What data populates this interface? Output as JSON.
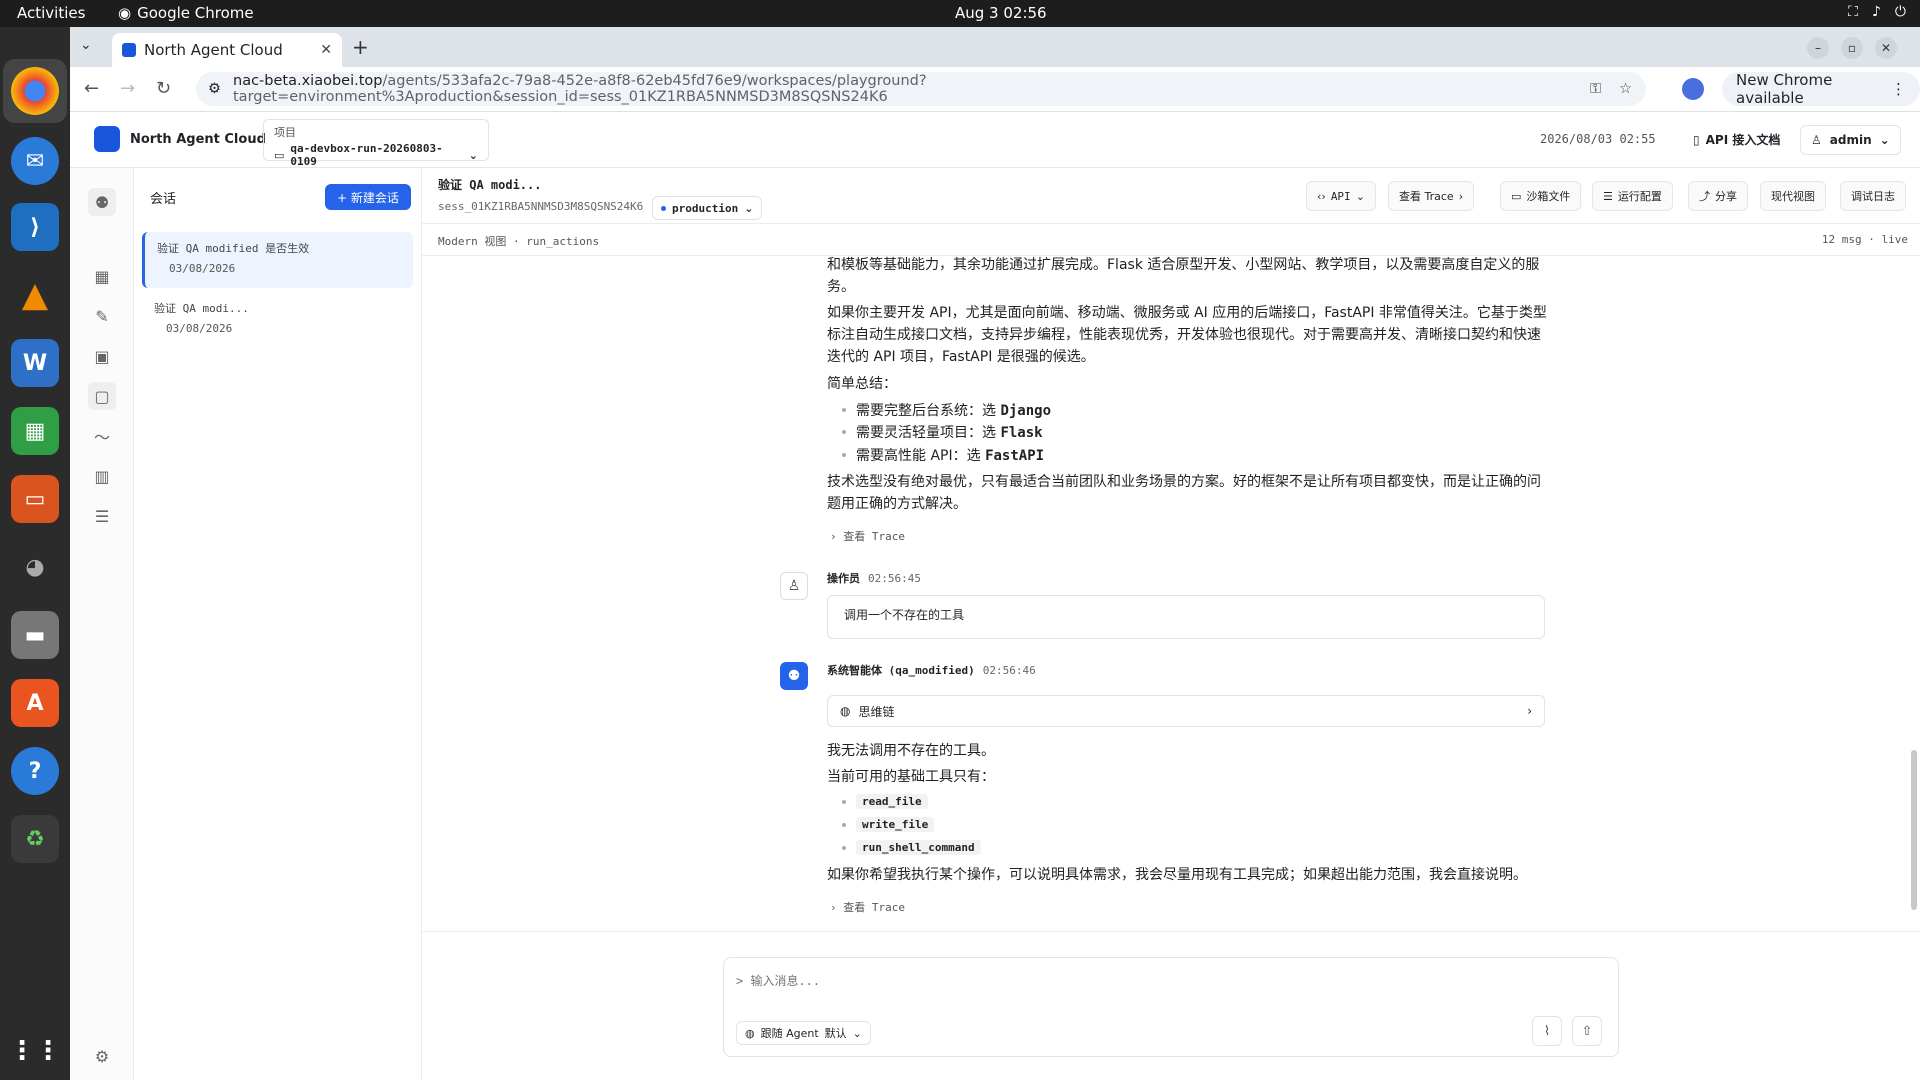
{
  "os": {
    "activities": "Activities",
    "app_name": "Google Chrome",
    "clock": "Aug 3  02:56"
  },
  "browser": {
    "tab_title": "North Agent Cloud",
    "url_host": "nac-beta.xiaobei.top",
    "url_path": "/agents/533afa2c-79a8-452e-a8f8-62eb45fd76e9/workspaces/playground?target=environment%3Aproduction&session_id=sess_01KZ1RBA5NNMSD3M8SQSNS24K6",
    "update_label": "New Chrome available"
  },
  "header": {
    "brand": "North Agent Cloud",
    "project_label": "项目",
    "project_value": "qa-devbox-run-20260803-0109",
    "datetime": "2026/08/03 02:55",
    "api_doc": "API 接入文档",
    "user": "admin"
  },
  "sessions": {
    "title": "会话",
    "new_label": "+ 新建会话",
    "items": [
      {
        "title": "验证 QA modified 是否生效",
        "date": "03/08/2026"
      },
      {
        "title": "验证 QA modi...",
        "date": "03/08/2026"
      }
    ]
  },
  "session_header": {
    "title": "验证 QA modi...",
    "id": "sess_01KZ1RBA5NNMSD3M8SQSNS24K6",
    "env": "production",
    "buttons": {
      "api": "API",
      "trace": "查看 Trace",
      "sandbox": "沙箱文件",
      "run_config": "运行配置",
      "share": "分享",
      "modern_view": "现代视图",
      "debug_log": "调试日志"
    }
  },
  "view_bar": {
    "left": "Modern 视图 · run_actions",
    "right": "12 msg · live"
  },
  "chat": {
    "p1": "和模板等基础能力，其余功能通过扩展完成。Flask 适合原型开发、小型网站、教学项目，以及需要高度自定义的服务。",
    "p2": "如果你主要开发 API，尤其是面向前端、移动端、微服务或 AI 应用的后端接口，FastAPI 非常值得关注。它基于类型标注自动生成接口文档，支持异步编程，性能表现优秀，开发体验也很现代。对于需要高并发、清晰接口契约和快速迭代的 API 项目，FastAPI 是很强的候选。",
    "summary_title": "简单总结：",
    "summary": [
      {
        "text": "需要完整后台系统：选 ",
        "bold": "Django"
      },
      {
        "text": "需要灵活轻量项目：选 ",
        "bold": "Flask"
      },
      {
        "text": "需要高性能 API：选 ",
        "bold": "FastAPI"
      }
    ],
    "p3": "技术选型没有绝对最优，只有最适合当前团队和业务场景的方案。好的框架不是让所有项目都变快，而是让正确的问题用正确的方式解决。",
    "trace_label": "查看 Trace",
    "user_msg": {
      "author": "操作员",
      "time": "02:56:45",
      "text": "调用一个不存在的工具"
    },
    "agent_msg": {
      "author": "系统智能体 (qa_modified)",
      "time": "02:56:46",
      "thinking": "思维链",
      "line1": "我无法调用不存在的工具。",
      "line2": "当前可用的基础工具只有：",
      "tools": [
        "read_file",
        "write_file",
        "run_shell_command"
      ],
      "line3": "如果你希望我执行某个操作，可以说明具体需求，我会尽量用现有工具完成；如果超出能力范围，我会直接说明。"
    }
  },
  "composer": {
    "placeholder": "> 输入消息...",
    "agent_label": "跟随 Agent",
    "agent_default": "默认"
  }
}
